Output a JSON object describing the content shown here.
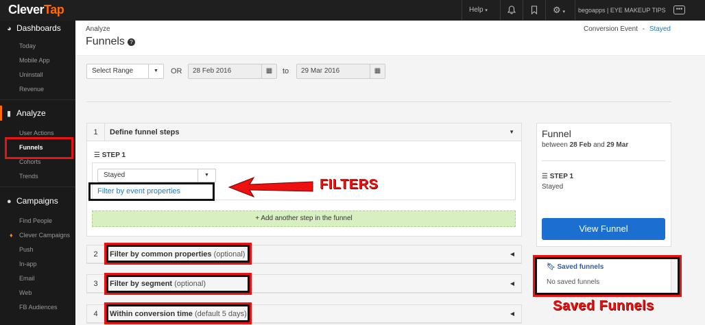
{
  "topbar": {
    "logo_a": "Clever",
    "logo_b": "Tap",
    "help": "Help",
    "account": "begoapps | EYE MAKEUP TIPS"
  },
  "sidebar": {
    "dashboards": "Dashboards",
    "dash_items": [
      "Today",
      "Mobile App",
      "Uninstall",
      "Revenue"
    ],
    "analyze": "Analyze",
    "analyze_items": [
      "User Actions",
      "Funnels",
      "Cohorts",
      "Trends"
    ],
    "campaigns": "Campaigns",
    "campaign_items": [
      "Find People",
      "Clever Campaigns",
      "Push",
      "In-app",
      "Email",
      "Web",
      "FB Audiences"
    ]
  },
  "header": {
    "breadcrumb": "Analyze",
    "title": "Funnels",
    "conv_label": "Conversion Event",
    "conv_sep": "-",
    "conv_value": "Stayed"
  },
  "range": {
    "select": "Select Range",
    "or": "OR",
    "from": "28 Feb 2016",
    "to_label": "to",
    "to": "29 Mar 2016"
  },
  "steps": {
    "p1_num": "1",
    "p1_title": "Define funnel steps",
    "step_label": "STEP 1",
    "event": "Stayed",
    "filter_link": "Filter by event properties",
    "add_step": "+ Add another step in the funnel",
    "p2_num": "2",
    "p2_title": "Filter by common properties",
    "p2_opt": "(optional)",
    "p3_num": "3",
    "p3_title": "Filter by segment",
    "p3_opt": "(optional)",
    "p4_num": "4",
    "p4_title": "Within conversion time",
    "p4_opt": "(default 5 days)"
  },
  "funnel_card": {
    "title": "Funnel",
    "between": "between",
    "from": "28 Feb",
    "and": "and",
    "to": "29 Mar",
    "step": "STEP 1",
    "event": "Stayed",
    "view_button": "View Funnel"
  },
  "saved": {
    "title": "Saved funnels",
    "empty": "No saved funnels"
  },
  "annotations": {
    "filters": "FILTERS",
    "saved_funnels": "Saved Funnels"
  },
  "colors": {
    "accent": "#ff6a00",
    "link": "#2a7ab8",
    "primary_button": "#1b6fd1",
    "annotation": "#ee1111"
  }
}
